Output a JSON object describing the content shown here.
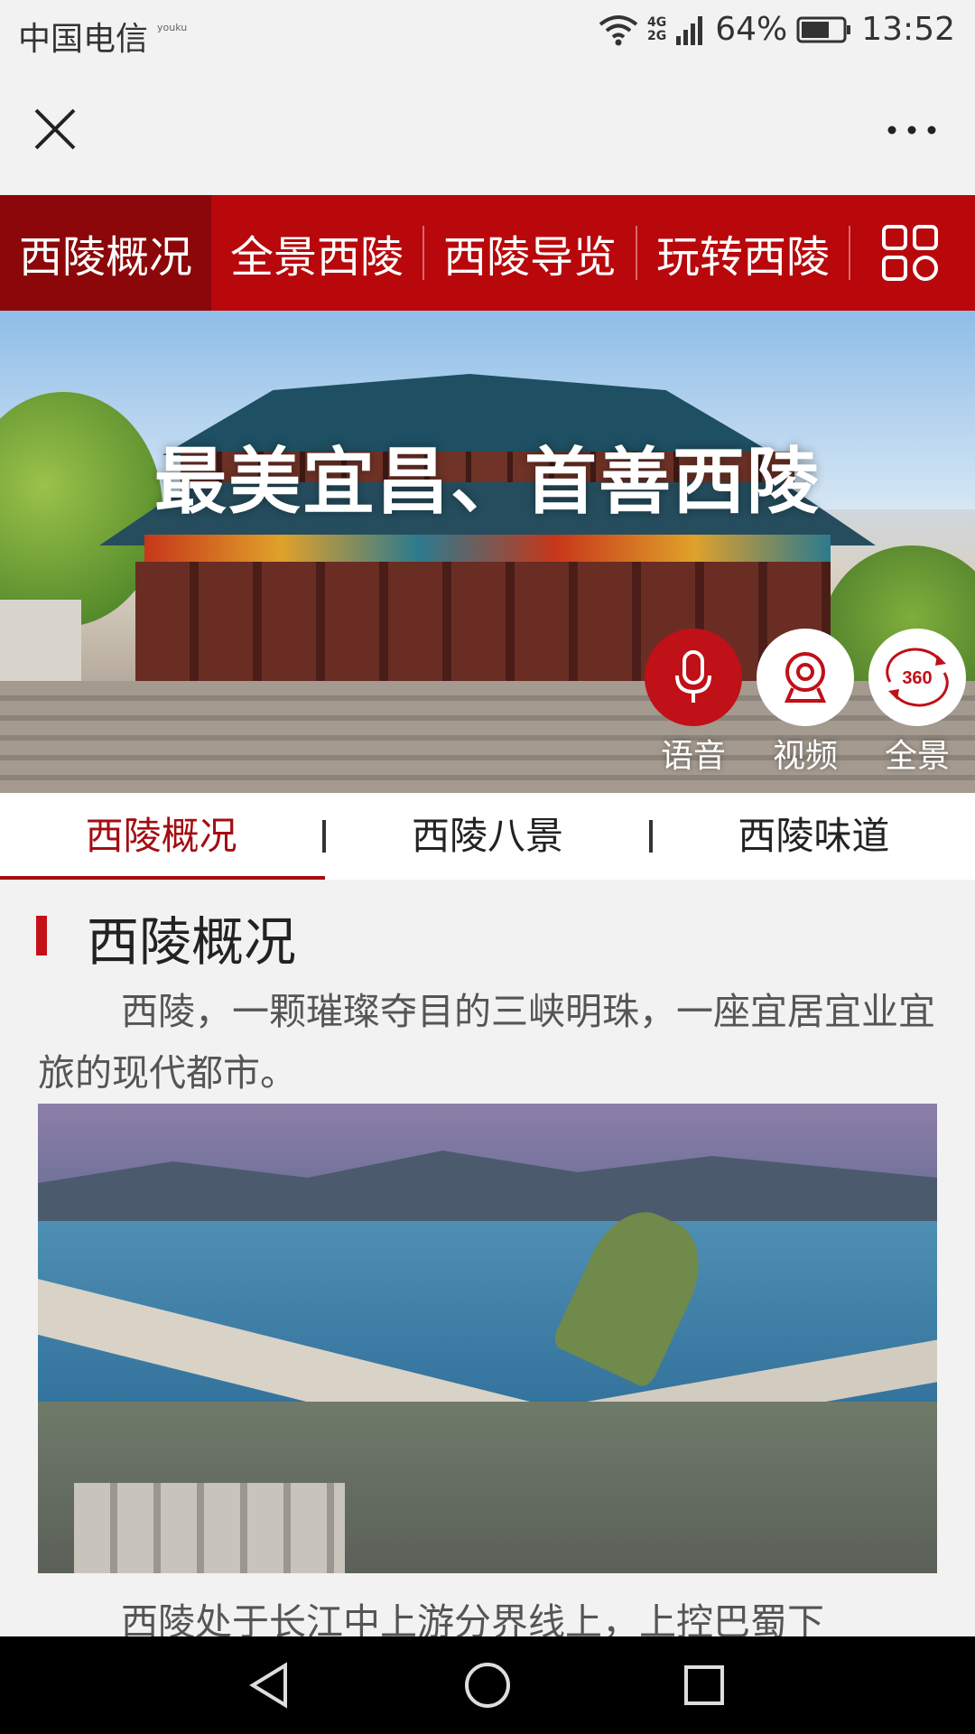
{
  "status_bar": {
    "carrier": "中国电信",
    "carrier_tag": "youku",
    "network": "4G\n2G",
    "battery": "64%",
    "time": "13:52"
  },
  "nav": {
    "items": [
      "西陵概况",
      "全景西陵",
      "西陵导览",
      "玩转西陵"
    ],
    "active_index": 0
  },
  "banner": {
    "slogan": "最美宜昌、首善西陵",
    "buttons": [
      {
        "label": "语音",
        "icon": "microphone-icon"
      },
      {
        "label": "视频",
        "icon": "camera-icon"
      },
      {
        "label": "全景",
        "icon": "panorama-360-icon",
        "icon_text": "360"
      }
    ]
  },
  "tabs": {
    "items": [
      "西陵概况",
      "西陵八景",
      "西陵味道"
    ],
    "active_index": 0
  },
  "section": {
    "title": "西陵概况",
    "paragraph1": "西陵，一颗璀璨夺目的三峡明珠，一座宜居宜业宜旅的现代都市。",
    "paragraph2": "西陵处于长江中上游分界线上，上控巴蜀下"
  },
  "colors": {
    "brand_red": "#b8080c",
    "active_red": "#8b0709",
    "tab_active": "#a30d12"
  }
}
